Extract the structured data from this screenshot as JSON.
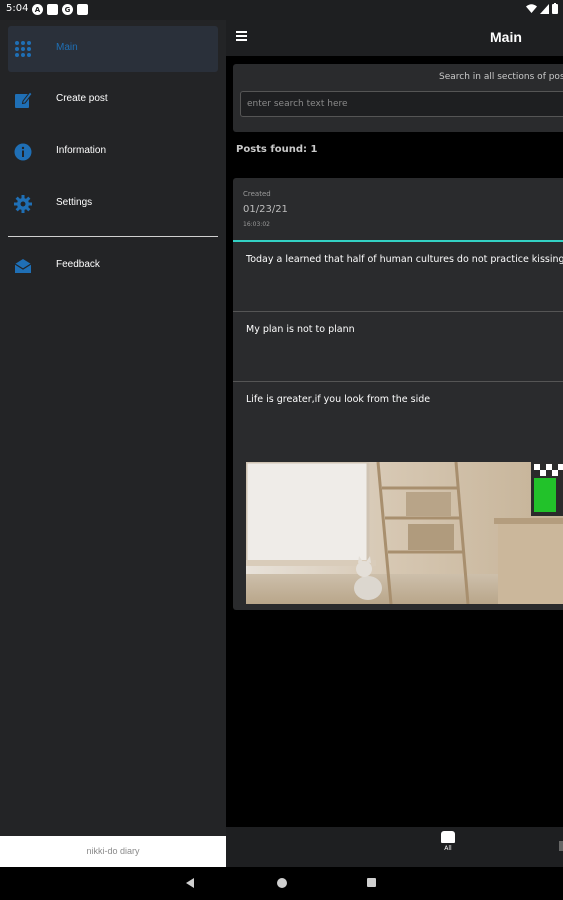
{
  "status_bar": {
    "time": "5:04"
  },
  "app": {
    "title": "Main",
    "search": {
      "hint": "Search in all sections of pos",
      "placeholder": "enter search text here",
      "value": ""
    },
    "posts_found": "Posts found: 1",
    "post": {
      "created_label": "Created",
      "date": "01/23/21",
      "time": "16:03:02",
      "entries": [
        "Today a learned that half of human cultures do not practice kissing or",
        "My plan is  not to plann",
        "Life is greater,if you look from the side"
      ]
    },
    "bottom_nav": {
      "tab_all": "All"
    }
  },
  "drawer": {
    "items": [
      {
        "label": "Main",
        "icon": "grid-icon",
        "active": true
      },
      {
        "label": "Create post",
        "icon": "edit-icon"
      },
      {
        "label": "Information",
        "icon": "info-icon"
      },
      {
        "label": "Settings",
        "icon": "gear-icon"
      },
      {
        "label": "Feedback",
        "icon": "mail-icon"
      }
    ],
    "footer": "nikki-do diary"
  },
  "colors": {
    "accent": "#1f6fb5",
    "divider_accent": "#33d1c4",
    "drawer_bg": "#232426",
    "card_bg": "#2a2b2d"
  }
}
